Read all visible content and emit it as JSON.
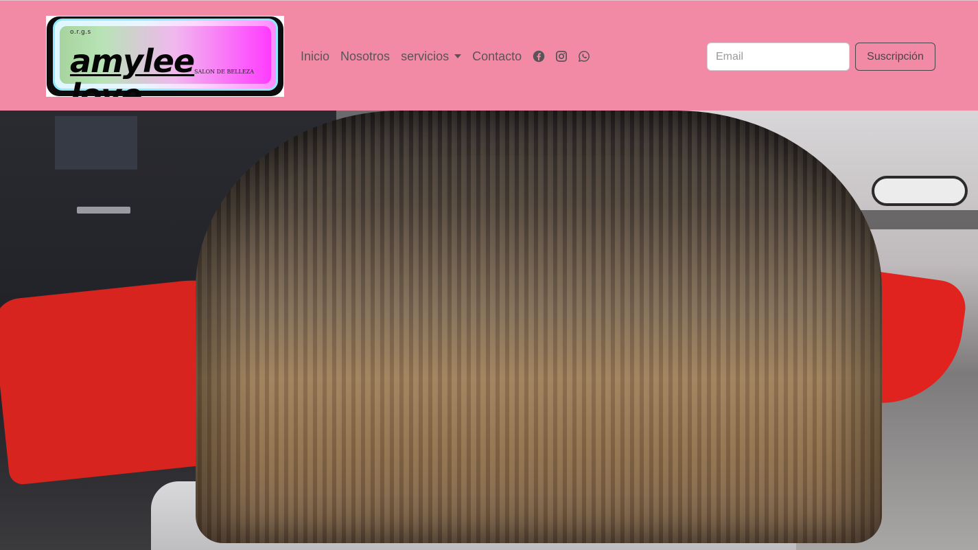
{
  "logo": {
    "small_text": "o.r.g.s",
    "title": "amylee love",
    "subtitle": "SALON DE BELLEZA"
  },
  "nav": {
    "items": [
      {
        "label": "Inicio"
      },
      {
        "label": "Nosotros"
      },
      {
        "label": "servicios",
        "dropdown": true
      },
      {
        "label": "Contacto"
      }
    ],
    "social_icons": [
      "facebook-icon",
      "instagram-icon",
      "whatsapp-icon"
    ]
  },
  "subscribe": {
    "email_placeholder": "Email",
    "button_label": "Suscripción"
  },
  "colors": {
    "navbar_bg": "#f28aa6",
    "nav_text": "#5a5458"
  }
}
